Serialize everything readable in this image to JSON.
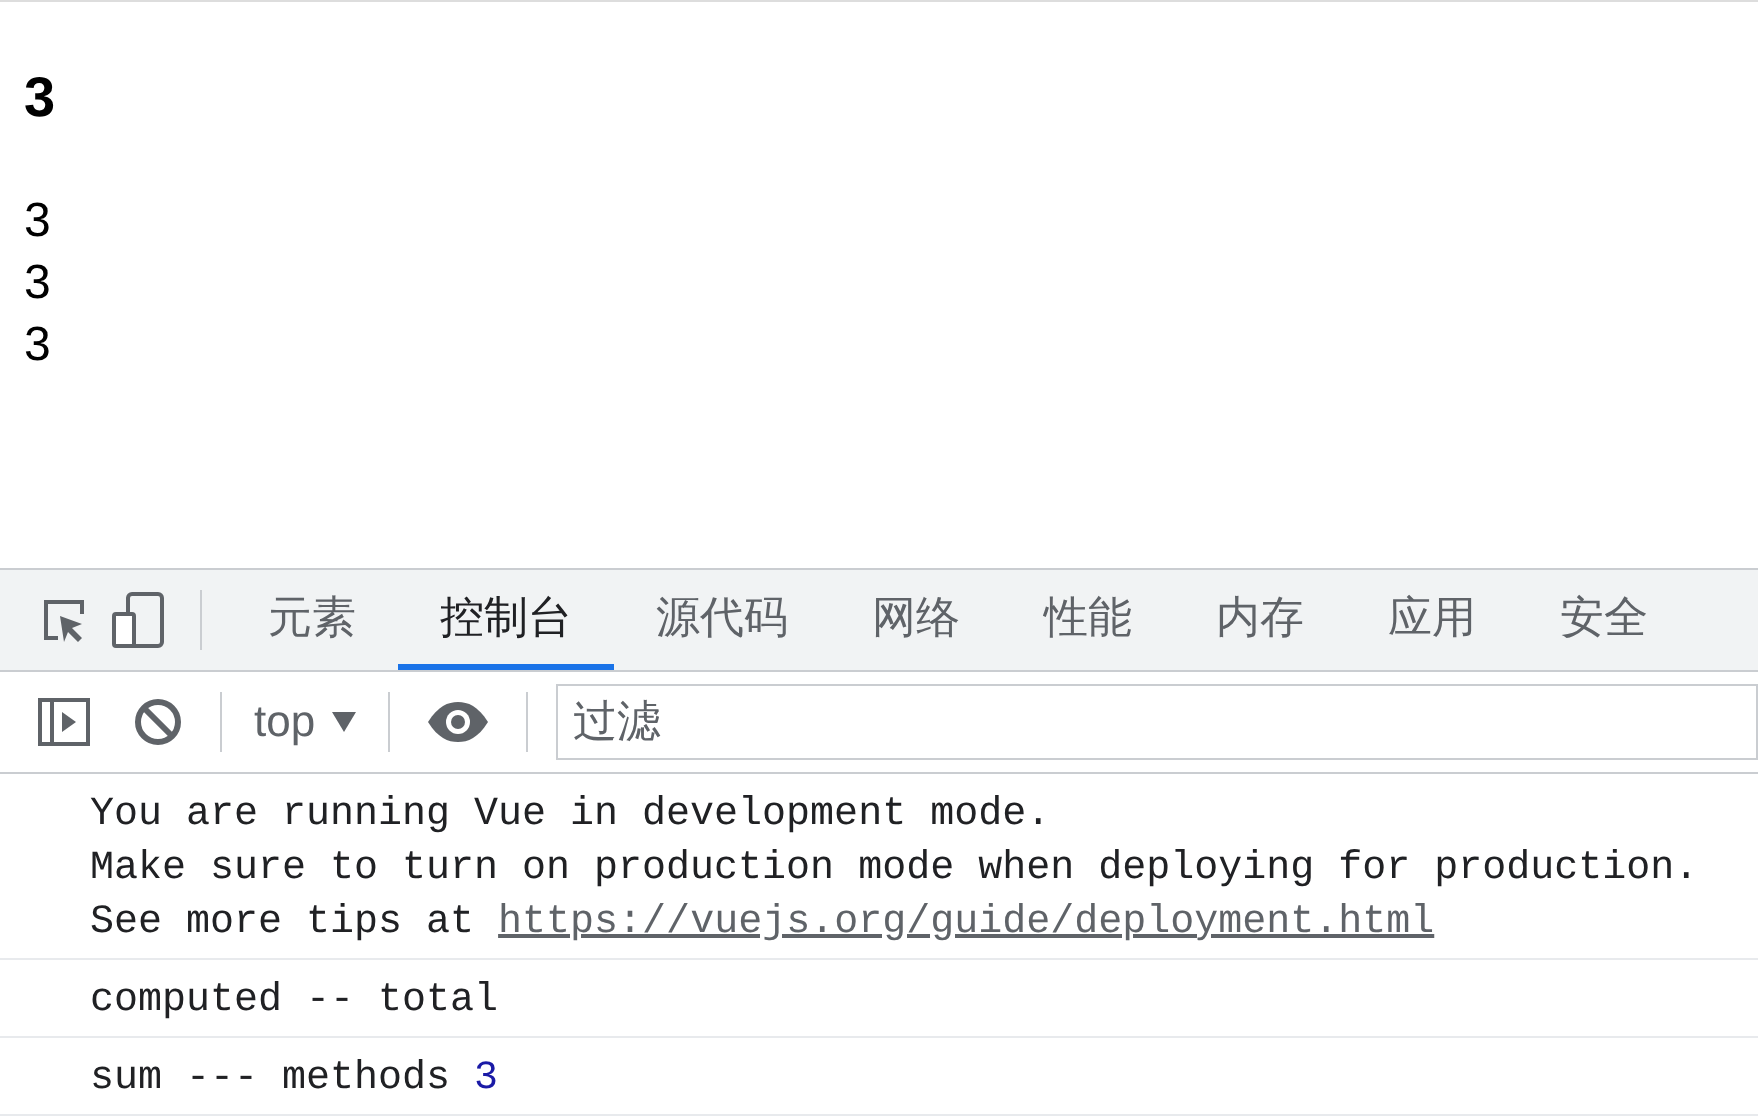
{
  "page": {
    "heading": "3",
    "lines": [
      "3",
      "3",
      "3"
    ]
  },
  "devtools": {
    "tabs": [
      {
        "label": "元素",
        "selected": false
      },
      {
        "label": "控制台",
        "selected": true
      },
      {
        "label": "源代码",
        "selected": false
      },
      {
        "label": "网络",
        "selected": false
      },
      {
        "label": "性能",
        "selected": false
      },
      {
        "label": "内存",
        "selected": false
      },
      {
        "label": "应用",
        "selected": false
      },
      {
        "label": "安全",
        "selected": false
      }
    ],
    "toolbar": {
      "context": "top",
      "filter": {
        "placeholder": "过滤"
      }
    },
    "console": [
      {
        "kind": "multiline",
        "lines": [
          {
            "text": "You are running Vue in development mode."
          },
          {
            "text": "Make sure to turn on production mode when deploying for production."
          },
          {
            "text": "See more tips at",
            "link": "https://vuejs.org/guide/deployment.html"
          }
        ]
      },
      {
        "kind": "log",
        "text": "computed -- total"
      },
      {
        "kind": "log",
        "text": "sum --- methods",
        "value": "3"
      }
    ]
  }
}
